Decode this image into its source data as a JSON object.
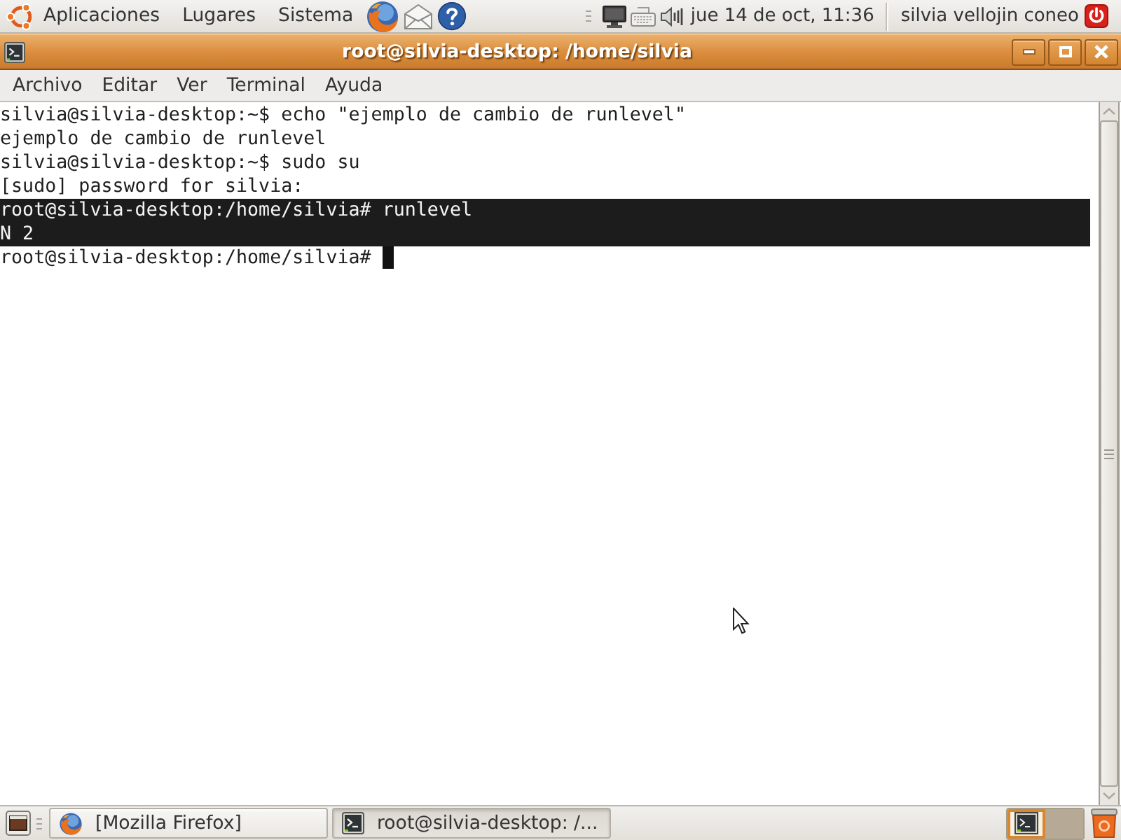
{
  "top_panel": {
    "menus": [
      {
        "label": "Aplicaciones"
      },
      {
        "label": "Lugares"
      },
      {
        "label": "Sistema"
      }
    ],
    "clock": "jue 14 de oct, 11:36",
    "user": "silvia vellojin coneo"
  },
  "window": {
    "title": "root@silvia-desktop: /home/silvia"
  },
  "menu_bar": [
    {
      "label": "Archivo"
    },
    {
      "label": "Editar"
    },
    {
      "label": "Ver"
    },
    {
      "label": "Terminal"
    },
    {
      "label": "Ayuda"
    }
  ],
  "terminal": {
    "lines": [
      {
        "text": "silvia@silvia-desktop:~$ echo \"ejemplo de cambio de runlevel\"",
        "selected": false,
        "cursor": false
      },
      {
        "text": "ejemplo de cambio de runlevel",
        "selected": false,
        "cursor": false
      },
      {
        "text": "silvia@silvia-desktop:~$ sudo su",
        "selected": false,
        "cursor": false
      },
      {
        "text": "[sudo] password for silvia:",
        "selected": false,
        "cursor": false
      },
      {
        "text": "root@silvia-desktop:/home/silvia# runlevel",
        "selected": true,
        "cursor": false
      },
      {
        "text": "N 2",
        "selected": true,
        "cursor": false
      },
      {
        "text": "root@silvia-desktop:/home/silvia#",
        "selected": false,
        "cursor": true
      }
    ]
  },
  "taskbar": {
    "buttons": [
      {
        "label": "[Mozilla Firefox]",
        "kind": "browser",
        "selected": false
      },
      {
        "label": "root@silvia-desktop: /...",
        "kind": "terminal",
        "selected": true
      }
    ],
    "workspaces": [
      {
        "selected": true,
        "has_window": true
      },
      {
        "selected": false,
        "has_window": false
      }
    ]
  }
}
